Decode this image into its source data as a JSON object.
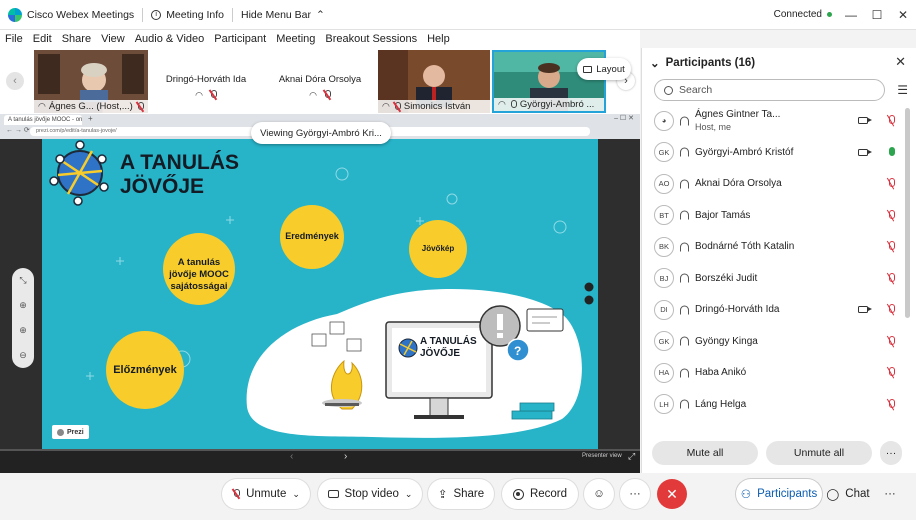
{
  "titlebar": {
    "app_name": "Cisco Webex Meetings",
    "meeting_info": "Meeting Info",
    "hide_menu": "Hide Menu Bar",
    "status": "Connected",
    "min": "—",
    "max": "☐",
    "close": "✕"
  },
  "menu": [
    "File",
    "Edit",
    "Share",
    "View",
    "Audio & Video",
    "Participant",
    "Meeting",
    "Breakout Sessions",
    "Help"
  ],
  "thumbnails": [
    {
      "name": "Ágnes G... (Host,...)",
      "type": "video"
    },
    {
      "name": "Dringó-Horváth Ida",
      "type": "blank"
    },
    {
      "name": "Aknai Dóra Orsolya",
      "type": "blank"
    },
    {
      "name": "Simonics István",
      "type": "video"
    },
    {
      "name": "Györgyi-Ambró ...",
      "type": "video"
    }
  ],
  "layout_label": "Layout",
  "viewing_label": "Viewing Györgyi-Ambró Kri...",
  "browser": {
    "tab_title": "A tanulás jövője MOOC - online...",
    "url": "prezi.com/p/edit/a-tanulas-jovoje/"
  },
  "slide": {
    "title_line1": "A TANULÁS",
    "title_line2": "JÖVŐJE",
    "bubble_results": "Eredmények",
    "bubble_vision": "Jövőkép",
    "bubble_mooc": "A tanulás jövője MOOC sajátosságai",
    "bubble_history": "Előzmények",
    "screen_title1": "A TANULÁS",
    "screen_title2": "JÖVŐJE",
    "prezi_badge": "Prezi",
    "presenter_view": "Presenter view",
    "colors": {
      "background": "#27b3c8",
      "bubble": "#f7cc2b"
    }
  },
  "participants": {
    "header": "Participants (16)",
    "search_placeholder": "Search",
    "list": [
      {
        "initials": "",
        "name": "Ágnes Gintner Ta...",
        "sub": "Host, me",
        "camera": true,
        "mic": "muted"
      },
      {
        "initials": "GK",
        "name": "Györgyi-Ambró Kristóf",
        "sub": "",
        "camera": true,
        "mic": "on"
      },
      {
        "initials": "AO",
        "name": "Aknai Dóra Orsolya",
        "sub": "",
        "camera": false,
        "mic": "muted"
      },
      {
        "initials": "BT",
        "name": "Bajor Tamás",
        "sub": "",
        "camera": false,
        "mic": "muted"
      },
      {
        "initials": "BK",
        "name": "Bodnárné Tóth Katalin",
        "sub": "",
        "camera": false,
        "mic": "muted"
      },
      {
        "initials": "BJ",
        "name": "Borszéki Judit",
        "sub": "",
        "camera": false,
        "mic": "muted"
      },
      {
        "initials": "DI",
        "name": "Dringó-Horváth Ida",
        "sub": "",
        "camera": true,
        "mic": "muted"
      },
      {
        "initials": "GK",
        "name": "Gyöngy Kinga",
        "sub": "",
        "camera": false,
        "mic": "muted"
      },
      {
        "initials": "HA",
        "name": "Haba Anikó",
        "sub": "",
        "camera": false,
        "mic": "muted"
      },
      {
        "initials": "LH",
        "name": "Láng Helga",
        "sub": "",
        "camera": false,
        "mic": "muted"
      }
    ],
    "mute_all": "Mute all",
    "unmute_all": "Unmute all"
  },
  "controls": {
    "unmute": "Unmute",
    "stop_video": "Stop video",
    "share": "Share",
    "record": "Record",
    "participants": "Participants",
    "chat": "Chat"
  }
}
